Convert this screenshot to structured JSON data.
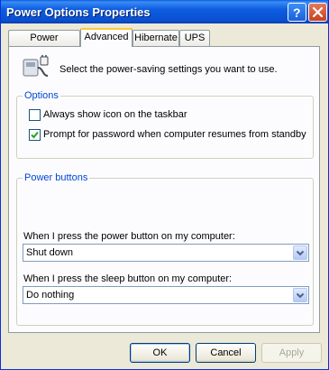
{
  "window": {
    "title": "Power Options Properties"
  },
  "tabs": [
    {
      "label": "Power Schemes",
      "active": false
    },
    {
      "label": "Advanced",
      "active": true
    },
    {
      "label": "Hibernate",
      "active": false
    },
    {
      "label": "UPS",
      "active": false
    }
  ],
  "advanced": {
    "intro_text": "Select the power-saving settings you want to use.",
    "options_group": {
      "legend": "Options",
      "checkbox_taskbar_icon": {
        "label": "Always show icon on the taskbar",
        "checked": false
      },
      "checkbox_password_prompt": {
        "label": "Prompt for password when computer resumes from standby",
        "checked": true
      }
    },
    "power_buttons_group": {
      "legend": "Power buttons",
      "power_button": {
        "label": "When I press the power button on my computer:",
        "value": "Shut down"
      },
      "sleep_button": {
        "label": "When I press the sleep button on my computer:",
        "value": "Do nothing"
      }
    }
  },
  "buttons": {
    "ok": "OK",
    "cancel": "Cancel",
    "apply": "Apply"
  },
  "colors": {
    "titlebar": "#0a5bde",
    "dialog_bg": "#ece9d8",
    "group_legend": "#0046d5",
    "active_tab_accent": "#ffc83c"
  },
  "icons": {
    "title_help": "question-mark-icon",
    "title_close": "close-x-icon",
    "power_options": "power-plug-icon",
    "checkmark": "checkmark-icon",
    "dropdown": "chevron-down-icon"
  }
}
